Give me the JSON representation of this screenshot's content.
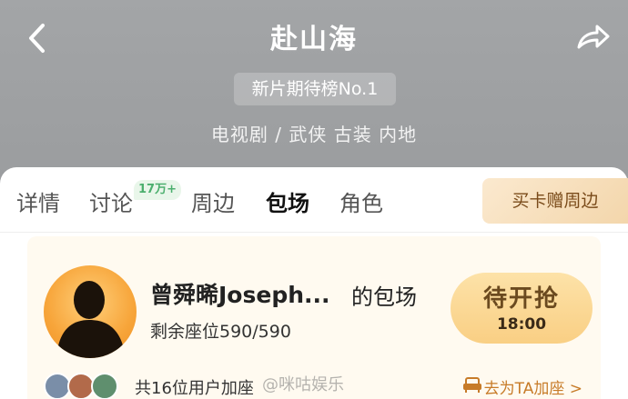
{
  "header": {
    "title": "赴山海",
    "rank_badge": "新片期待榜No.1",
    "genre": "电视剧 / 武侠 古装 内地"
  },
  "tabs": [
    {
      "label": "详情",
      "active": false
    },
    {
      "label": "讨论",
      "active": false,
      "badge": "17万+"
    },
    {
      "label": "周边",
      "active": false
    },
    {
      "label": "包场",
      "active": true
    },
    {
      "label": "角色",
      "active": false
    }
  ],
  "buy_card_button": "买卡赠周边",
  "booking": {
    "host_name": "曾舜晞Joseph...",
    "host_suffix": "的包场",
    "seats": "剩余座位590/590",
    "pending_label": "待开抢",
    "pending_time": "18:00",
    "joined_text": "共16位用户加座",
    "join_link": "去为TA加座 >"
  },
  "watermark": "@咪咕娱乐",
  "colors": {
    "accent": "#c77b28",
    "badge_green": "#4caf6e",
    "button_gold": "#f9cf84"
  }
}
